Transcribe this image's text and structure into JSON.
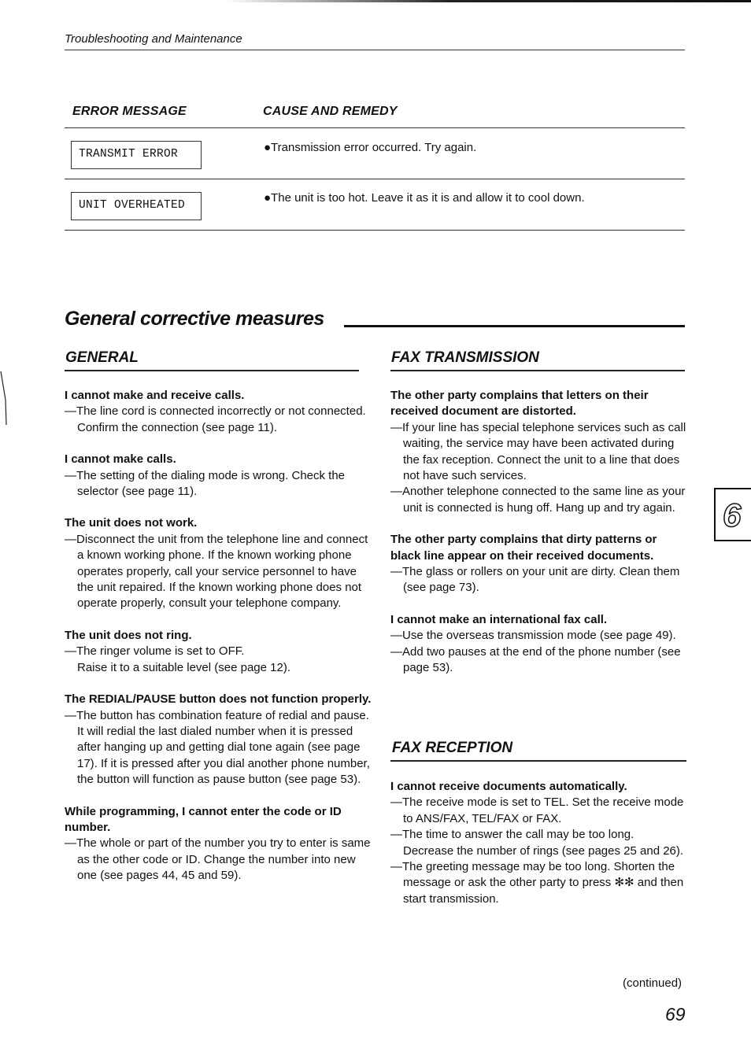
{
  "running_head": "Troubleshooting and Maintenance",
  "error_table": {
    "headers": {
      "message": "ERROR MESSAGE",
      "remedy": "CAUSE AND REMEDY"
    },
    "rows": [
      {
        "message": "TRANSMIT ERROR",
        "remedy": "●Transmission error occurred. Try again."
      },
      {
        "message": "UNIT OVERHEATED",
        "remedy": "●The unit is too hot. Leave it as it is and allow it to cool down."
      }
    ]
  },
  "section_title": "General corrective measures",
  "general": {
    "heading": "GENERAL",
    "items": [
      {
        "q": "I cannot make and receive calls.",
        "a": [
          "—The line cord is connected incorrectly or not connected. Confirm the connection (see page 11)."
        ]
      },
      {
        "q": "I cannot make calls.",
        "a": [
          "—The setting of the dialing mode is wrong. Check the selector (see page 11)."
        ]
      },
      {
        "q": "The unit does not work.",
        "a": [
          "—Disconnect the unit from the telephone line and connect a known working phone. If the known working phone operates properly, call your service personnel to have the unit repaired. If the known working phone does not operate properly, consult your telephone company."
        ]
      },
      {
        "q": "The unit does not ring.",
        "a": [
          "—The ringer volume is set to OFF.",
          "Raise it to a suitable level (see page 12)."
        ]
      },
      {
        "q": "The REDIAL/PAUSE button does not function properly.",
        "a": [
          "—The button has combination feature of redial and pause. It will redial the last dialed number when it is pressed after hanging up and getting dial tone again (see page 17). If it is pressed after you dial another phone number, the button will function as pause button (see page 53)."
        ]
      },
      {
        "q": "While programming, I cannot enter the code or ID number.",
        "a": [
          "—The whole or part of the number you try to enter is same as the other code or ID. Change the number into new one (see pages 44, 45 and 59)."
        ]
      }
    ]
  },
  "fax_transmission": {
    "heading": "FAX TRANSMISSION",
    "items": [
      {
        "q": "The other party complains that letters on their received document are distorted.",
        "a": [
          "—If your line has special telephone services such as call waiting, the service may have been activated during the fax reception. Connect the unit to a line that does not have such services.",
          "—Another telephone connected to the same line as your unit is connected is hung off. Hang up and try again."
        ]
      },
      {
        "q": "The other party complains that dirty patterns or black line appear on their received documents.",
        "a": [
          "—The glass or rollers on your unit are dirty. Clean them (see page 73)."
        ]
      },
      {
        "q": "I cannot make an international fax call.",
        "a": [
          "—Use the overseas transmission mode (see page 49).",
          "—Add two pauses at the end of the phone number (see page 53)."
        ]
      }
    ]
  },
  "fax_reception": {
    "heading": "FAX RECEPTION",
    "items": [
      {
        "q": "I cannot receive documents automatically.",
        "a": [
          "—The receive mode is set to TEL. Set the receive mode to ANS/FAX, TEL/FAX or FAX.",
          "—The time to answer the call may be too long. Decrease the number of rings (see pages 25 and 26).",
          "—The greeting message may be too long. Shorten the message or ask the other party to press ✻✻ and then start transmission."
        ]
      }
    ]
  },
  "chapter_tab": "6",
  "continued": "(continued)",
  "page_number": "69"
}
